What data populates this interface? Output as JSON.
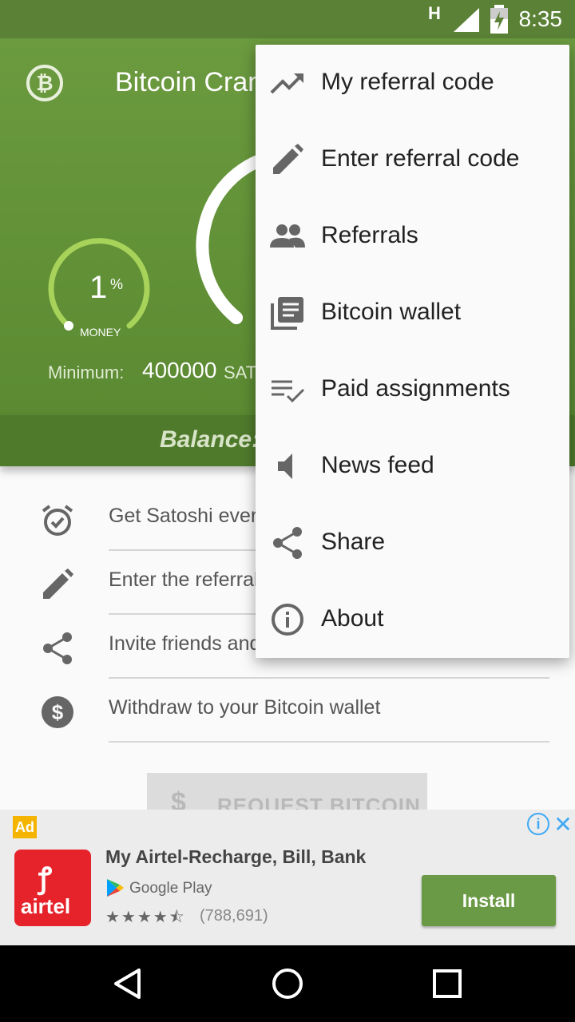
{
  "status_bar": {
    "network": "H",
    "time": "8:35"
  },
  "header": {
    "app_title": "Bitcoin Crane",
    "money_percent": "1",
    "money_percent_sign": "%",
    "money_label": "MONEY",
    "minimum_label": "Minimum:",
    "minimum_value": "400000",
    "minimum_unit": "SAT",
    "balance_label": "Balance:"
  },
  "list": [
    {
      "text": "Get Satoshi every",
      "icon": "alarm-check-icon"
    },
    {
      "text": "Enter the referral",
      "icon": "pencil-icon"
    },
    {
      "text": "Invite friends and",
      "icon": "share-icon"
    },
    {
      "text": "Withdraw to your Bitcoin wallet",
      "icon": "dollar-circle-icon"
    }
  ],
  "request_button": {
    "label": "REQUEST BITCOIN"
  },
  "menu": [
    {
      "label": "My referral code",
      "icon": "trending-up-icon"
    },
    {
      "label": "Enter referral code",
      "icon": "pencil-icon"
    },
    {
      "label": "Referrals",
      "icon": "people-icon"
    },
    {
      "label": "Bitcoin wallet",
      "icon": "library-books-icon"
    },
    {
      "label": "Paid assignments",
      "icon": "playlist-check-icon"
    },
    {
      "label": "News feed",
      "icon": "speaker-icon"
    },
    {
      "label": "Share",
      "icon": "share-icon"
    },
    {
      "label": "About",
      "icon": "info-icon"
    }
  ],
  "ad": {
    "badge": "Ad",
    "logo_text": "airtel",
    "title": "My Airtel-Recharge, Bill, Bank",
    "store": "Google Play",
    "rating": 4.5,
    "stars": "★★★★⯪",
    "reviews": "(788,691)",
    "install_label": "Install"
  },
  "colors": {
    "primary": "#5b8a32",
    "menu_bg": "#fafafa",
    "install": "#6b9a46"
  }
}
